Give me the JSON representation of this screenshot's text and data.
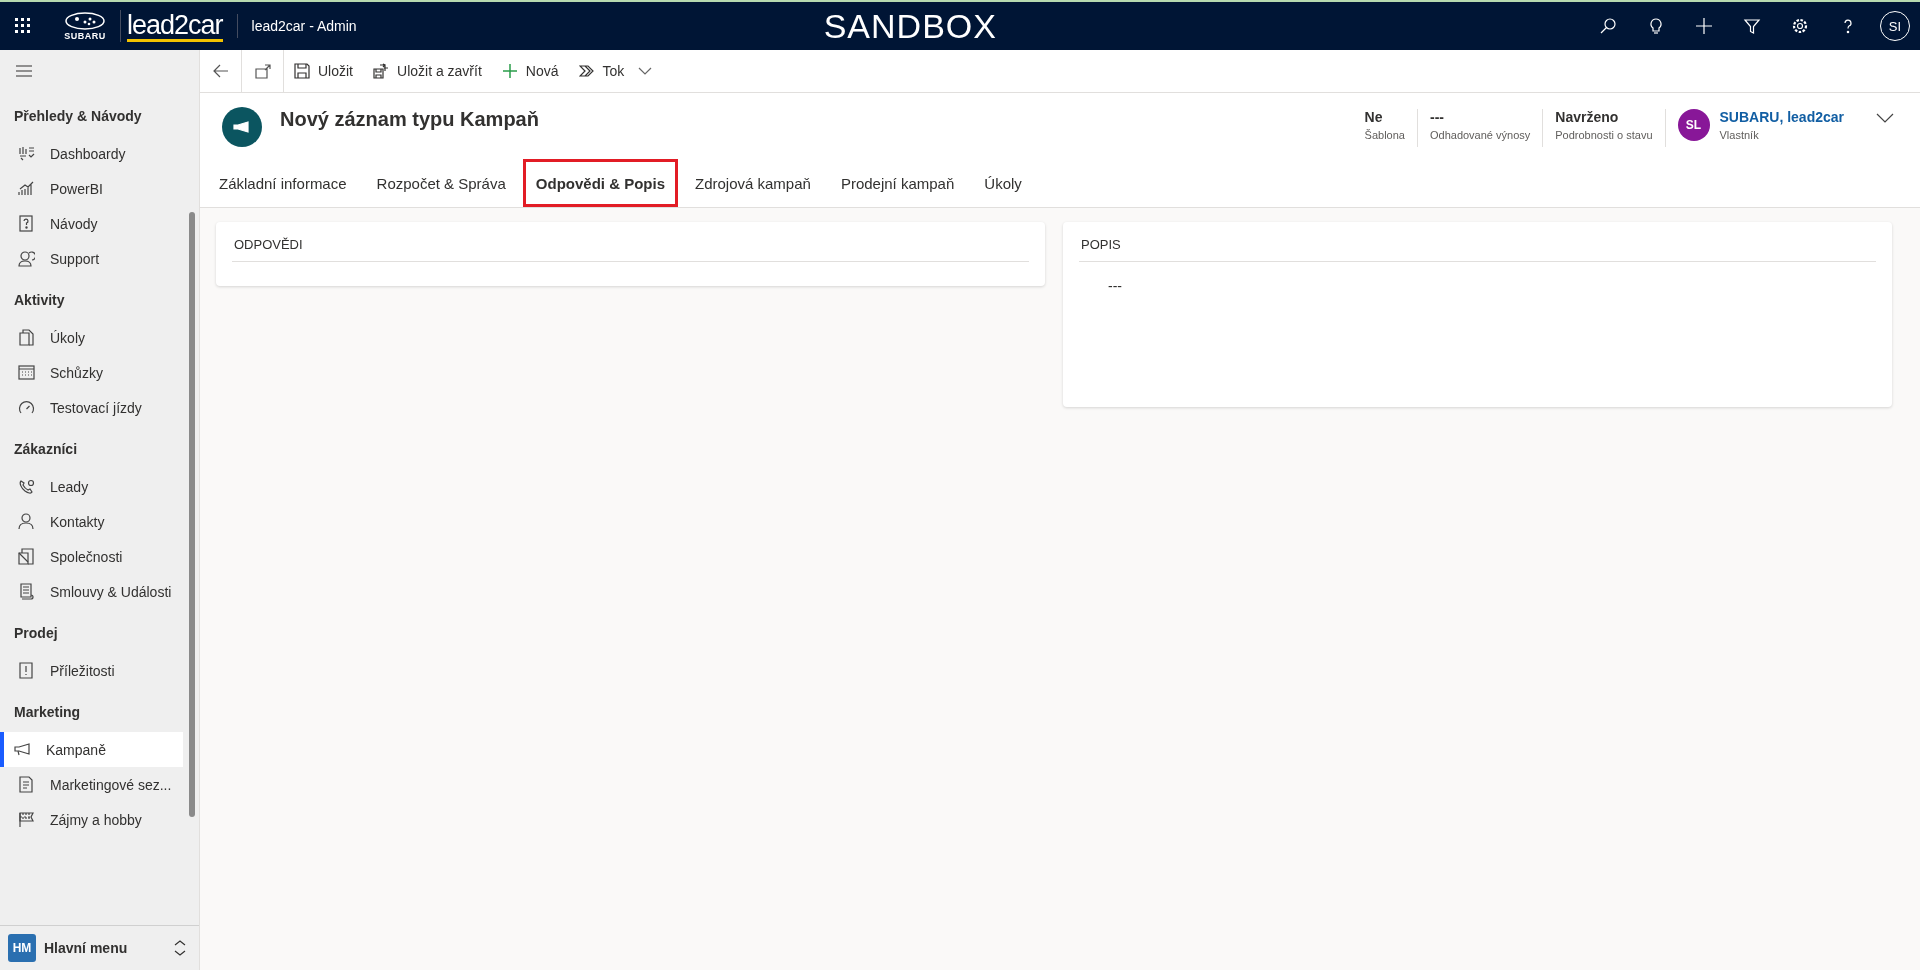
{
  "top_bar": {
    "brand_caption": "SUBARU",
    "product": "lead2car",
    "app_title": "lead2car - Admin",
    "environment": "SANDBOX",
    "user_initials": "SI"
  },
  "command_bar": {
    "buttons": [
      {
        "kind": "save",
        "label": "Uložit"
      },
      {
        "kind": "save_close",
        "label": "Uložit a zavřít"
      },
      {
        "kind": "new",
        "label": "Nová"
      },
      {
        "kind": "flow",
        "label": "Tok"
      }
    ]
  },
  "sidebar": {
    "sections": [
      {
        "title": "Přehledy & Návody",
        "items": [
          {
            "label": "Dashboardy",
            "selected": false
          },
          {
            "label": "PowerBI",
            "selected": false
          },
          {
            "label": "Návody",
            "selected": false
          },
          {
            "label": "Support",
            "selected": false
          }
        ]
      },
      {
        "title": "Aktivity",
        "items": [
          {
            "label": "Úkoly",
            "selected": false
          },
          {
            "label": "Schůzky",
            "selected": false
          },
          {
            "label": "Testovací jízdy",
            "selected": false
          }
        ]
      },
      {
        "title": "Zákazníci",
        "items": [
          {
            "label": "Leady",
            "selected": false
          },
          {
            "label": "Kontakty",
            "selected": false
          },
          {
            "label": "Společnosti",
            "selected": false
          },
          {
            "label": "Smlouvy & Události",
            "selected": false
          }
        ]
      },
      {
        "title": "Prodej",
        "items": [
          {
            "label": "Příležitosti",
            "selected": false
          }
        ]
      },
      {
        "title": "Marketing",
        "items": [
          {
            "label": "Kampaně",
            "selected": true
          },
          {
            "label": "Marketingové sez...",
            "selected": false
          },
          {
            "label": "Zájmy a hobby",
            "selected": false
          }
        ]
      }
    ],
    "area_switcher": {
      "initials": "HM",
      "label": "Hlavní menu"
    }
  },
  "record": {
    "title": "Nový záznam typu Kampaň",
    "header_fields": [
      {
        "value": "Ne",
        "label": "Šablona"
      },
      {
        "value": "---",
        "label": "Odhadované výnosy"
      },
      {
        "value": "Navrženo",
        "label": "Podrobnosti o stavu"
      }
    ],
    "owner": {
      "initials": "SL",
      "name": "SUBARU, lead2car",
      "label": "Vlastník"
    },
    "tabs": [
      {
        "label": "Základní informace",
        "selected": false
      },
      {
        "label": "Rozpočet & Správa",
        "selected": false
      },
      {
        "label": "Odpovědi & Popis",
        "selected": true
      },
      {
        "label": "Zdrojová kampaň",
        "selected": false
      },
      {
        "label": "Prodejní kampaň",
        "selected": false
      },
      {
        "label": "Úkoly",
        "selected": false
      }
    ],
    "sections": [
      {
        "title": "ODPOVĚDI"
      },
      {
        "title": "POPIS",
        "value": "---"
      }
    ]
  }
}
